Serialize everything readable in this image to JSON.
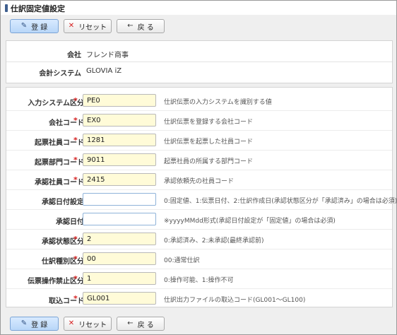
{
  "page": {
    "title": "仕訳固定値設定"
  },
  "toolbar": {
    "save_label": "登 録",
    "reset_label": "リセット",
    "back_label": "戻 る"
  },
  "info": {
    "company_label": "会社",
    "company_value": "フレンド商事",
    "system_label": "会計システム",
    "system_value": "GLOVIA iZ"
  },
  "form": {
    "rows": [
      {
        "label": "入力システム区分",
        "required": "*",
        "value": "PE0",
        "description": "仕訳伝票の入力システムを識別する値"
      },
      {
        "label": "会社コード",
        "required": "*",
        "value": "EX0",
        "description": "仕訳伝票を登録する会社コード"
      },
      {
        "label": "起票社員コード",
        "required": "*",
        "value": "1281",
        "description": "仕訳伝票を起票した社員コード"
      },
      {
        "label": "起票部門コード",
        "required": "*",
        "value": "9011",
        "description": "起票社員の所属する部門コード"
      },
      {
        "label": "承認社員コード",
        "required": "*",
        "value": "2415",
        "description": "承認依頼先の社員コード"
      },
      {
        "label": "承認日付設定",
        "required": "",
        "value": "",
        "description": "0:固定値、1:伝票日付、2:仕訳作成日(承認状態区分が「承認済み」の場合は必須)"
      },
      {
        "label": "承認日付",
        "required": "",
        "value": "",
        "description": "※yyyyMMdd形式(承認日付設定が「固定値」の場合は必須)"
      },
      {
        "label": "承認状態区分",
        "required": "*",
        "value": "2",
        "description": "0:承認済み、2:未承認(最終承認前)"
      },
      {
        "label": "仕訳種別区分",
        "required": "*",
        "value": "00",
        "description": "00:通常仕訳"
      },
      {
        "label": "伝票操作禁止区分",
        "required": "*",
        "value": "1",
        "description": "0:操作可能、1:操作不可"
      },
      {
        "label": "取込コード",
        "required": "*",
        "value": "GL001",
        "description": "仕訳出力ファイルの取込コード(GL001〜GL100)"
      }
    ]
  }
}
